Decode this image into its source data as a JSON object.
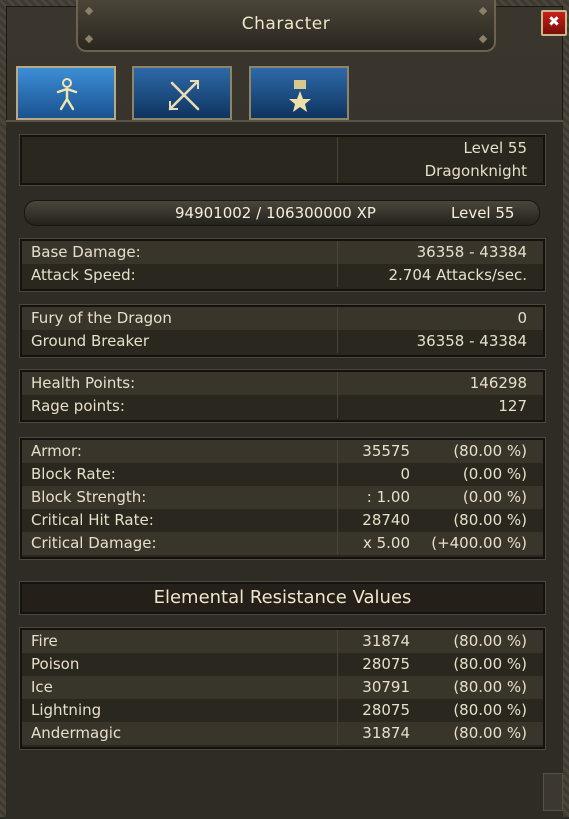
{
  "window": {
    "title": "Character",
    "close_label": "✖"
  },
  "tabs": [
    {
      "name": "character-tab",
      "icon": "person-icon",
      "active": true
    },
    {
      "name": "equipment-tab",
      "icon": "crossed-swords-icon",
      "active": false
    },
    {
      "name": "achievements-tab",
      "icon": "medal-icon",
      "active": false
    }
  ],
  "header": {
    "level": "Level 55",
    "class_name": "Dragonknight"
  },
  "xp": {
    "text": "94901002 / 106300000 XP",
    "level": "Level 55",
    "fraction": 0.8928
  },
  "combat": [
    {
      "label": "Base Damage:",
      "value": "36358 - 43384"
    },
    {
      "label": "Attack Speed:",
      "value": "2.704 Attacks/sec."
    }
  ],
  "skills": [
    {
      "label": "Fury of the Dragon",
      "value": "0"
    },
    {
      "label": "Ground Breaker",
      "value": "36358 - 43384"
    }
  ],
  "vitals": [
    {
      "label": "Health Points:",
      "value": "146298"
    },
    {
      "label": "Rage points:",
      "value": "127"
    }
  ],
  "defense": [
    {
      "label": "Armor:",
      "value": "35575",
      "pct": "(80.00 %)"
    },
    {
      "label": "Block Rate:",
      "value": "0",
      "pct": "(0.00 %)"
    },
    {
      "label": "Block Strength:",
      "value": ": 1.00",
      "pct": "(0.00 %)"
    },
    {
      "label": "Critical Hit Rate:",
      "value": "28740",
      "pct": "(80.00 %)"
    },
    {
      "label": "Critical Damage:",
      "value": "x 5.00",
      "pct": "(+400.00 %)"
    }
  ],
  "resistance_title": "Elemental Resistance Values",
  "resistances": [
    {
      "label": "Fire",
      "value": "31874",
      "pct": "(80.00 %)"
    },
    {
      "label": "Poison",
      "value": "28075",
      "pct": "(80.00 %)"
    },
    {
      "label": "Ice",
      "value": "30791",
      "pct": "(80.00 %)"
    },
    {
      "label": "Lightning",
      "value": "28075",
      "pct": "(80.00 %)"
    },
    {
      "label": "Andermagic",
      "value": "31874",
      "pct": "(80.00 %)"
    }
  ]
}
